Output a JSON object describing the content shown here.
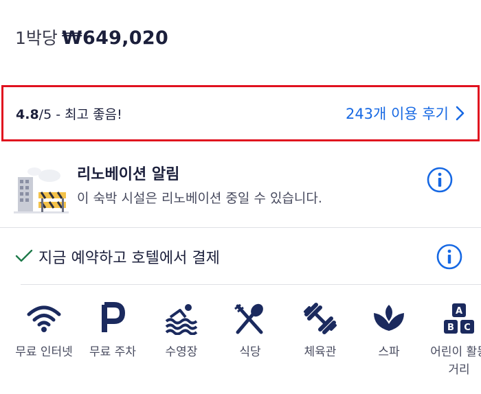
{
  "price": {
    "prefix": "1박당",
    "amount": "₩649,020"
  },
  "review": {
    "score": "4.8",
    "scale": "/5",
    "rating_text": " - 최고 좋음!",
    "link_label": "243개 이용 후기",
    "link_color": "#1668e3",
    "highlight_color": "#e0101e"
  },
  "renovation": {
    "title": "리노베이션 알림",
    "description": "이 숙박 시설은 리노베이션 중일 수 있습니다.",
    "icon": "info-icon"
  },
  "payment": {
    "text": "지금 예약하고 호텔에서 결제",
    "icon": "checkmark-icon"
  },
  "amenities": [
    {
      "icon": "wifi-icon",
      "label": "무료 인터넷"
    },
    {
      "icon": "parking-icon",
      "label": "무료 주차"
    },
    {
      "icon": "pool-icon",
      "label": "수영장"
    },
    {
      "icon": "restaurant-icon",
      "label": "식당"
    },
    {
      "icon": "gym-icon",
      "label": "체육관"
    },
    {
      "icon": "spa-icon",
      "label": "스파"
    },
    {
      "icon": "kids-activities-icon",
      "label": "어린이 활동거리"
    }
  ],
  "colors": {
    "icon_navy": "#1b2a5e",
    "text_dark": "#1b1f3b",
    "text_muted": "#474a5e",
    "info_blue": "#1668e3"
  }
}
